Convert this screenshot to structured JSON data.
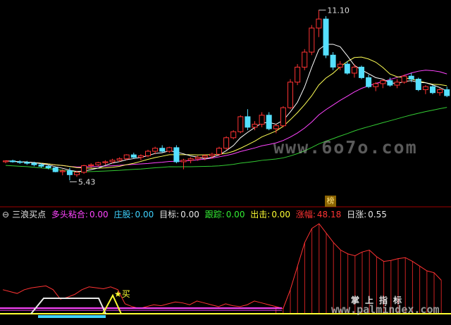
{
  "top_label": "",
  "price_high_label": "11.10",
  "price_low_label": "5.43",
  "watermark_main": "www.6o7o.com",
  "watermark_sub_title": "掌上指标",
  "watermark_sub_url": "www.palmindex.com",
  "buy_marker": "买",
  "rank_badge": "榜",
  "indicator": {
    "collapse_icon": "⊖",
    "name": "三浪买点",
    "fields": [
      {
        "label": "多头粘合:",
        "value": "0.00",
        "color": "#ff44ff"
      },
      {
        "label": "庄股:",
        "value": "0.00",
        "color": "#3fd3ff"
      },
      {
        "label": "目标:",
        "value": "0.00",
        "color": "#e8e8e8"
      },
      {
        "label": "跟踪:",
        "value": "0.00",
        "color": "#33ee33"
      },
      {
        "label": "出击:",
        "value": "0.00",
        "color": "#ffff33"
      },
      {
        "label": "涨幅:",
        "value": "48.18",
        "color": "#ff3333"
      },
      {
        "label": "日涨:",
        "value": "0.55",
        "color": "#e8e8e8"
      }
    ]
  },
  "colors": {
    "up": "#ff3333",
    "down": "#55e0ff",
    "ma5": "#ffffff",
    "ma10": "#ffff55",
    "ma20": "#ff44ff",
    "ma60": "#33cc33",
    "axis": "#a00000"
  },
  "candles": [
    [
      6.05,
      6.1,
      6.0,
      6.08
    ],
    [
      6.08,
      6.12,
      6.02,
      6.05
    ],
    [
      6.05,
      6.1,
      5.98,
      6.03
    ],
    [
      6.03,
      6.08,
      5.95,
      6.0
    ],
    [
      6.0,
      6.05,
      5.9,
      5.95
    ],
    [
      5.95,
      6.0,
      5.85,
      5.9
    ],
    [
      5.9,
      5.95,
      5.8,
      5.85
    ],
    [
      5.85,
      5.88,
      5.7,
      5.72
    ],
    [
      5.72,
      5.8,
      5.6,
      5.75
    ],
    [
      5.75,
      5.85,
      5.43,
      5.62
    ],
    [
      5.62,
      5.75,
      5.55,
      5.7
    ],
    [
      5.7,
      5.95,
      5.65,
      5.92
    ],
    [
      5.92,
      6.0,
      5.85,
      5.95
    ],
    [
      5.95,
      6.05,
      5.9,
      6.02
    ],
    [
      6.02,
      6.1,
      5.95,
      6.05
    ],
    [
      6.05,
      6.15,
      6.0,
      6.1
    ],
    [
      6.1,
      6.2,
      6.05,
      6.15
    ],
    [
      6.15,
      6.3,
      6.1,
      6.28
    ],
    [
      6.28,
      6.35,
      6.15,
      6.2
    ],
    [
      6.2,
      6.3,
      6.1,
      6.25
    ],
    [
      6.25,
      6.45,
      6.2,
      6.4
    ],
    [
      6.4,
      6.55,
      6.3,
      6.5
    ],
    [
      6.5,
      6.6,
      6.35,
      6.4
    ],
    [
      6.4,
      6.55,
      6.35,
      6.52
    ],
    [
      6.52,
      6.6,
      6.0,
      6.05
    ],
    [
      6.05,
      6.15,
      5.8,
      6.1
    ],
    [
      6.1,
      6.2,
      6.0,
      6.15
    ],
    [
      6.15,
      6.25,
      6.08,
      6.2
    ],
    [
      6.2,
      6.3,
      6.1,
      6.25
    ],
    [
      6.25,
      6.35,
      6.15,
      6.3
    ],
    [
      6.3,
      6.55,
      6.25,
      6.5
    ],
    [
      6.5,
      6.9,
      6.45,
      6.85
    ],
    [
      6.85,
      7.1,
      6.8,
      7.05
    ],
    [
      7.05,
      7.6,
      7.0,
      7.55
    ],
    [
      7.55,
      7.8,
      7.1,
      7.2
    ],
    [
      7.2,
      7.4,
      7.1,
      7.3
    ],
    [
      7.3,
      7.7,
      7.2,
      7.6
    ],
    [
      7.6,
      7.7,
      7.1,
      7.15
    ],
    [
      7.15,
      7.3,
      7.0,
      7.25
    ],
    [
      7.25,
      7.9,
      7.2,
      7.85
    ],
    [
      7.85,
      8.8,
      7.8,
      8.7
    ],
    [
      8.7,
      9.3,
      8.6,
      9.2
    ],
    [
      9.2,
      9.8,
      9.1,
      9.7
    ],
    [
      9.7,
      10.6,
      9.6,
      10.5
    ],
    [
      10.5,
      11.1,
      10.2,
      10.8
    ],
    [
      10.8,
      10.9,
      9.5,
      9.6
    ],
    [
      9.6,
      9.7,
      9.1,
      9.2
    ],
    [
      9.2,
      9.4,
      9.1,
      9.3
    ],
    [
      9.3,
      9.4,
      8.95,
      9.0
    ],
    [
      9.0,
      9.3,
      8.85,
      9.2
    ],
    [
      9.2,
      9.25,
      8.8,
      8.85
    ],
    [
      8.85,
      8.95,
      8.5,
      8.55
    ],
    [
      8.55,
      8.7,
      8.4,
      8.65
    ],
    [
      8.65,
      8.8,
      8.5,
      8.75
    ],
    [
      8.75,
      8.85,
      8.55,
      8.6
    ],
    [
      8.6,
      8.8,
      8.5,
      8.7
    ],
    [
      8.7,
      8.95,
      8.65,
      8.9
    ],
    [
      8.9,
      9.0,
      8.7,
      8.8
    ],
    [
      8.8,
      8.85,
      8.4,
      8.45
    ],
    [
      8.45,
      8.6,
      8.3,
      8.55
    ],
    [
      8.55,
      8.6,
      8.3,
      8.35
    ],
    [
      8.35,
      8.5,
      8.25,
      8.45
    ],
    [
      8.45,
      8.55,
      8.2,
      8.25
    ]
  ],
  "indicator_curve": [
    0.3,
    0.28,
    0.26,
    0.3,
    0.32,
    0.33,
    0.34,
    0.3,
    0.2,
    0.22,
    0.25,
    0.3,
    0.33,
    0.32,
    0.31,
    0.33,
    0.3,
    0.15,
    0.12,
    0.1,
    0.12,
    0.14,
    0.13,
    0.15,
    0.17,
    0.16,
    0.14,
    0.18,
    0.16,
    0.14,
    0.12,
    0.15,
    0.13,
    0.12,
    0.14,
    0.18,
    0.16,
    0.14,
    0.12,
    0.1,
    0.3,
    0.55,
    0.8,
    0.95,
    1.0,
    0.9,
    0.8,
    0.72,
    0.68,
    0.66,
    0.7,
    0.72,
    0.65,
    0.6,
    0.61,
    0.63,
    0.64,
    0.6,
    0.55,
    0.5,
    0.48,
    0.4
  ]
}
